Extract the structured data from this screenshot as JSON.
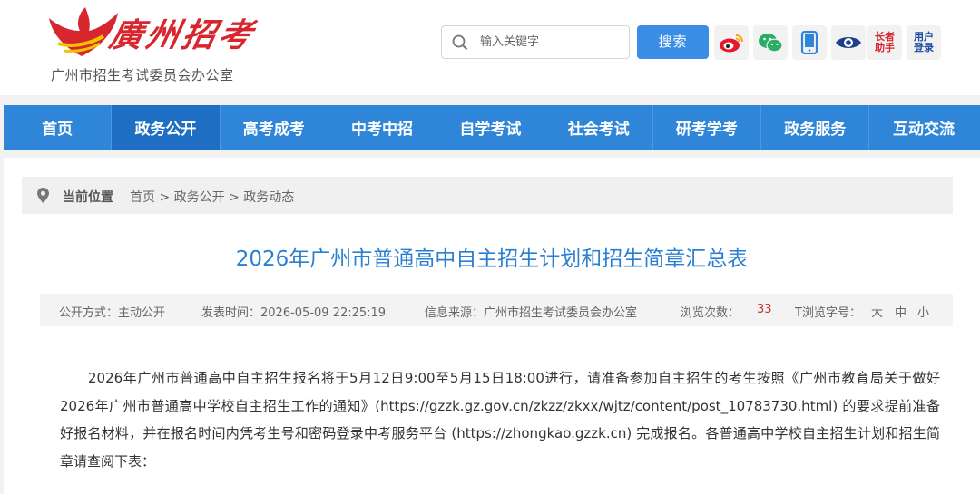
{
  "header": {
    "logo_text": "廣州招考",
    "subtitle": "广州市招生考试委员会办公室",
    "search": {
      "placeholder": "输入关键字",
      "button_label": "搜索"
    },
    "tools": [
      {
        "icon": "weibo-icon"
      },
      {
        "icon": "wechat-icon"
      },
      {
        "icon": "mobile-icon"
      },
      {
        "icon": "eye-icon"
      },
      {
        "icon": "elder-assistant-icon",
        "label_line1": "长者",
        "label_line2": "助手"
      },
      {
        "icon": "user-login-icon",
        "label_line1": "用户",
        "label_line2": "登录"
      }
    ]
  },
  "nav": {
    "items": [
      "首页",
      "政务公开",
      "高考成考",
      "中考中招",
      "自学考试",
      "社会考试",
      "研考学考",
      "政务服务",
      "互动交流"
    ],
    "active": "政务公开"
  },
  "breadcrumb": {
    "label": "当前位置",
    "path": "首页 > 政务公开 > 政务动态"
  },
  "article": {
    "title": "2026年广州市普通高中自主招生计划和招生简章汇总表",
    "meta": {
      "disclosure": "公开方式：主动公开",
      "published": "发表时间：2026-05-09 22:25:19",
      "source": "信息来源：广州市招生考试委员会办公室",
      "views_label": "浏览次数：",
      "views": "33",
      "font_size_label": "T浏览字号：",
      "size_large": "大",
      "size_medium": "中",
      "size_small": "小"
    },
    "body": "2026年广州市普通高中自主招生报名将于5月12日9:00至5月15日18:00进行，请准备参加自主招生的考生按照《广州市教育局关于做好2026年广州市普通高中学校自主招生工作的通知》(https://gzzk.gz.gov.cn/zkzz/zkxx/wjtz/content/post_10783730.html) 的要求提前准备好报名材料，并在报名时间内凭考生号和密码登录中考服务平台 (https://zhongkao.gzzk.cn) 完成报名。各普通高中学校自主招生计划和招生简章请查阅下表："
  },
  "colors": {
    "brand_red": "#d8262e",
    "nav_blue": "#2f86d8",
    "nav_active": "#1e6fc3",
    "title_blue": "#2a7fd2",
    "views_red": "#c3302d"
  }
}
